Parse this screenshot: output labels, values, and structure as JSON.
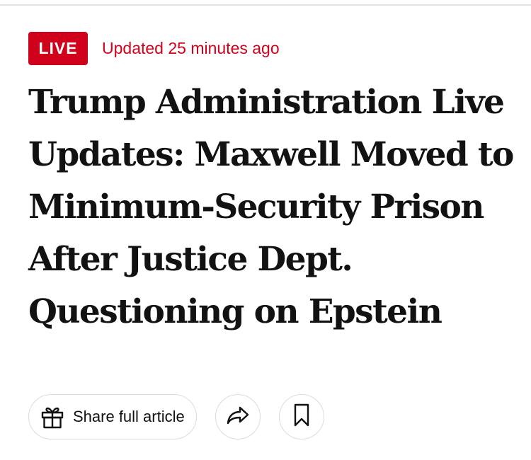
{
  "article": {
    "live_badge": "LIVE",
    "updated": "Updated 25 minutes ago",
    "headline": "Trump Administration Live Updates: Maxwell Moved to Minimum-Security Prison After Justice Dept. Questioning on Epstein"
  },
  "actions": {
    "share_full_article": "Share full article",
    "icons": {
      "gift": "gift-icon",
      "share": "share-arrow-icon",
      "save": "bookmark-icon"
    }
  },
  "colors": {
    "accent_red": "#d0021b",
    "headline_text": "#121212",
    "border": "#dcdcdc"
  }
}
